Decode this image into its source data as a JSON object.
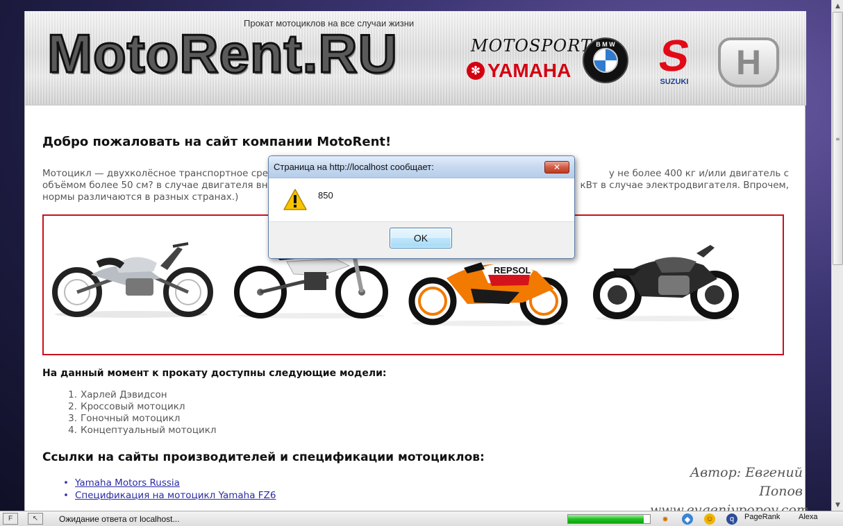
{
  "banner": {
    "tagline": "Прокат мотоциклов на все случаи жизни",
    "logo": "MotoRent.RU",
    "brands": {
      "motosport": "MOTOSPORT",
      "yamaha": "YAMAHA",
      "bmw": "B M W",
      "suzuki": "SUZUKI",
      "honda": "H"
    }
  },
  "content": {
    "welcome": "Добро пожаловать на сайт компании MotoRent!",
    "intro_line1": "Мотоцикл — двухколёсное транспортное сре",
    "intro_line1_right": "у не более 400 кг и/или двигатель с",
    "intro_line2": "объёмом более 50 см? в случае двигателя вн",
    "intro_line2_right": "кВт в случае электродвигателя. Впрочем,",
    "intro_line3": "нормы различаются в разных странах.)",
    "models_heading": "На данный момент к прокату доступны следующие модели:",
    "models": [
      {
        "num": "1.",
        "label": "Харлей Дэвидсон"
      },
      {
        "num": "2.",
        "label": "Кроссовый мотоцикл"
      },
      {
        "num": "3.",
        "label": "Гоночный мотоцикл"
      },
      {
        "num": "4.",
        "label": "Концептуальный мотоцикл"
      }
    ],
    "links_heading": "Ссылки на сайты производителей и спецификации мотоциклов:",
    "links": [
      {
        "label": "Yamaha Motors Russia"
      },
      {
        "label": "Спецификация на мотоцикл Yamaha FZ6"
      }
    ],
    "signature_name": "Автор: Евгений Попов",
    "signature_site": "www.evgeniypopov.com"
  },
  "dialog": {
    "title": "Страница на http://localhost сообщает:",
    "message": "850",
    "ok_label": "OK",
    "close_glyph": "✕"
  },
  "statusbar": {
    "text": "Ожидание ответа от localhost...",
    "progress_fraction": 0.92,
    "pagerank_label": "PageRank",
    "alexa_label": "Alexa"
  }
}
